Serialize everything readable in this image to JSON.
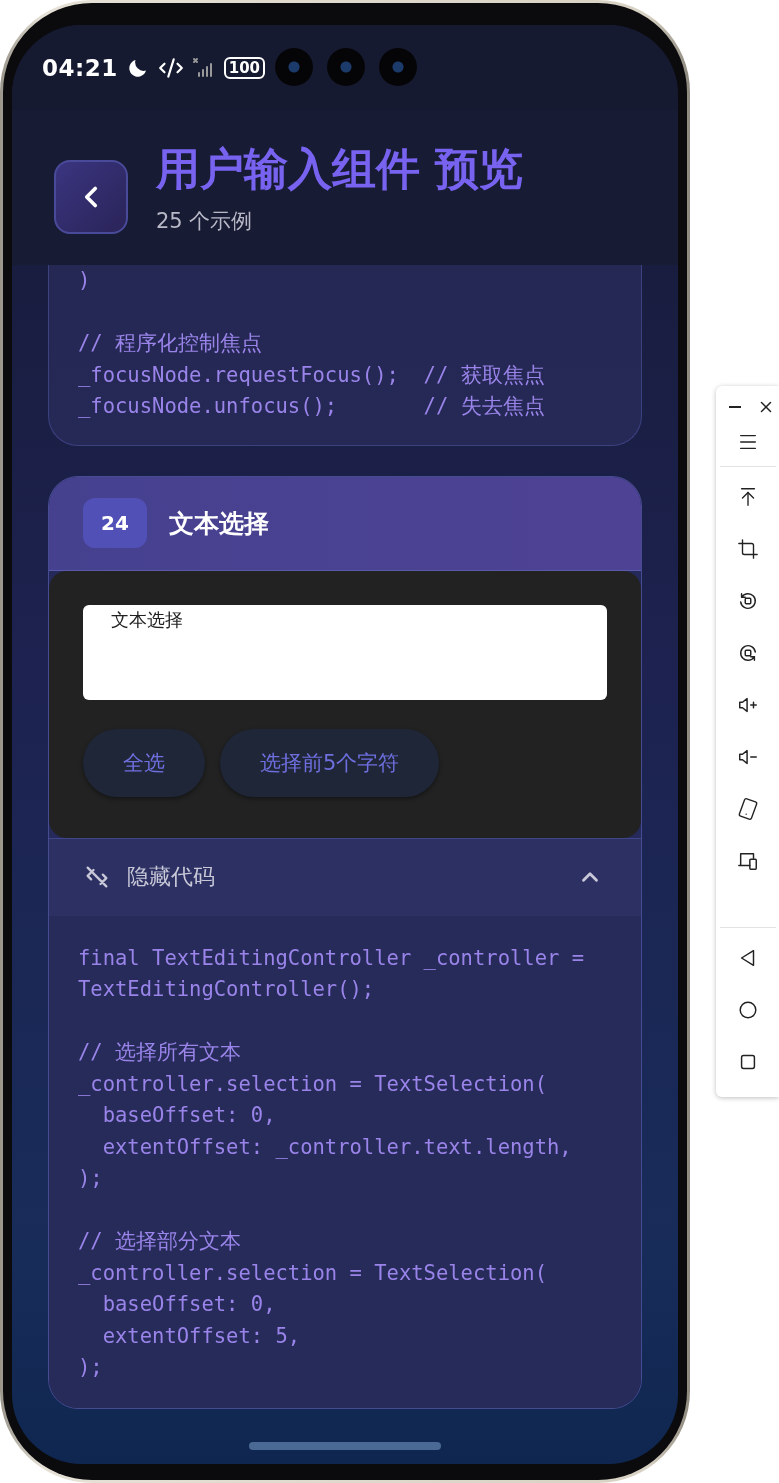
{
  "status_bar": {
    "time": "04:21",
    "battery": "100"
  },
  "header": {
    "title": "用户输入组件 预览",
    "subtitle": "25 个示例"
  },
  "cards": [
    {
      "code": ")\n\n// 程序化控制焦点\n_focusNode.requestFocus();  // 获取焦点\n_focusNode.unfocus();       // 失去焦点"
    },
    {
      "number": "24",
      "title": "文本选择",
      "demo": {
        "field_label": "文本选择",
        "buttons": [
          "全选",
          "选择前5个字符"
        ]
      },
      "code_toggle": {
        "label": "隐藏代码",
        "expanded": true
      },
      "code": "final TextEditingController _controller = TextEditingController();\n\n// 选择所有文本\n_controller.selection = TextSelection(\n  baseOffset: 0,\n  extentOffset: _controller.text.length,\n);\n\n// 选择部分文本\n_controller.selection = TextSelection(\n  baseOffset: 0,\n  extentOffset: 5,\n);"
    }
  ]
}
